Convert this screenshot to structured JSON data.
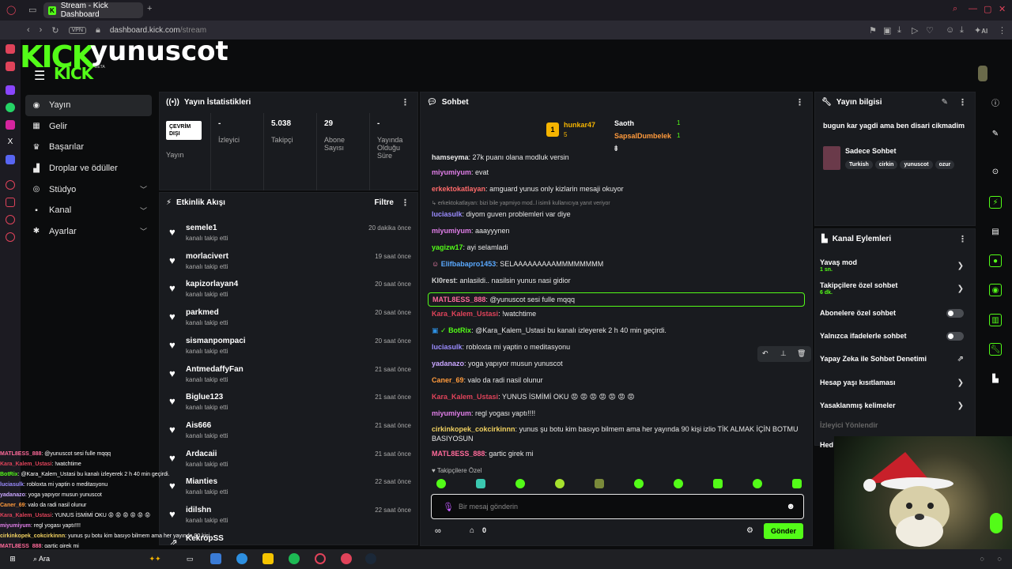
{
  "browser": {
    "tab_title": "Stream - Kick Dashboard",
    "vpn_label": "VPN",
    "url_host": "dashboard.kick.com",
    "url_path": "/stream",
    "ai_label": "AI"
  },
  "header": {
    "logo_top": "KICK",
    "logo_bottom": "KICK",
    "beta": "BETA",
    "channel_name": "yunuscot"
  },
  "nav": {
    "items": [
      {
        "label": "Yayın",
        "icon": "broadcast-icon"
      },
      {
        "label": "Gelir",
        "icon": "revenue-icon"
      },
      {
        "label": "Başarılar",
        "icon": "trophy-icon"
      },
      {
        "label": "Droplar ve ödüller",
        "icon": "gift-icon"
      },
      {
        "label": "Stüdyo",
        "icon": "studio-icon"
      },
      {
        "label": "Kanal",
        "icon": "channel-icon"
      },
      {
        "label": "Ayarlar",
        "icon": "gear-icon"
      }
    ]
  },
  "stats": {
    "title": "Yayın İstatistikleri",
    "offline_badge": "ÇEVRİM DIŞI",
    "broadcast_label": "Yayın",
    "viewers_value": "-",
    "viewers_label": "İzleyici",
    "followers_value": "5.038",
    "followers_label": "Takipçi",
    "subs_value": "29",
    "subs_label": "Abone Sayısı",
    "uptime_value": "-",
    "uptime_label": "Yayında Olduğu Süre"
  },
  "activity": {
    "title": "Etkinlik Akışı",
    "filter_label": "Filtre",
    "items": [
      {
        "user": "semele1",
        "action": "kanalı takip etti",
        "time": "20 dakika önce"
      },
      {
        "user": "morlacivert",
        "action": "kanalı takip etti",
        "time": "19 saat önce"
      },
      {
        "user": "kapizorlayan4",
        "action": "kanalı takip etti",
        "time": "20 saat önce"
      },
      {
        "user": "parkmed",
        "action": "kanalı takip etti",
        "time": "20 saat önce"
      },
      {
        "user": "sismanpompaci",
        "action": "kanalı takip etti",
        "time": "20 saat önce"
      },
      {
        "user": "AntmedaffyFan",
        "action": "kanalı takip etti",
        "time": "21 saat önce"
      },
      {
        "user": "Biglue123",
        "action": "kanalı takip etti",
        "time": "21 saat önce"
      },
      {
        "user": "Ais666",
        "action": "kanalı takip etti",
        "time": "21 saat önce"
      },
      {
        "user": "Ardacaii",
        "action": "kanalı takip etti",
        "time": "21 saat önce"
      },
      {
        "user": "Mianties",
        "action": "kanalı takip etti",
        "time": "22 saat önce"
      },
      {
        "user": "idilshn",
        "action": "kanalı takip etti",
        "time": "22 saat önce"
      },
      {
        "user": "KekropSS",
        "action": "",
        "time": ""
      }
    ]
  },
  "chat": {
    "title": "Sohbet",
    "leaderboard": [
      {
        "rank": "1",
        "user": "hunkar47",
        "count": "5"
      },
      {
        "rank": "",
        "user": "Saoth",
        "count": "1"
      },
      {
        "rank": "",
        "user": "SapsalDumbelek",
        "count": "1"
      }
    ],
    "messages": [
      {
        "user": "hamseyma",
        "color": "#e8e8e8",
        "text": "27k puanı olana modluk versin"
      },
      {
        "user": "miyumiyum",
        "color": "#e07ee8",
        "text": "evat"
      },
      {
        "user": "erkektokatlayan",
        "color": "#ff6a6a",
        "text": "amguard yunus only kizlarin mesaji okuyor"
      },
      {
        "user": "",
        "color": "#888888",
        "text": "erkektokatlayan: bizi bile yapmiyo mod..l isimli kullanıcıya yanıt veriyor"
      },
      {
        "user": "luciasulk",
        "color": "#9b8cff",
        "text": "diyom guven problemleri var diye"
      },
      {
        "user": "miyumiyum",
        "color": "#e07ee8",
        "text": "aaayyynen"
      },
      {
        "user": "yagizw17",
        "color": "#53fc18",
        "text": "ayi selamladi"
      },
      {
        "user": "Elifbabapro1453",
        "color": "#5aa9ff",
        "text": "SELAAAAAAAAAMMMMMMMM"
      },
      {
        "user": "Kl0rest",
        "color": "#d0d0d0",
        "text": "anlasildi.. nasilsin yunus nasi gidior"
      },
      {
        "user": "MATL8ESS_888",
        "color": "#ff6a9a",
        "text": "@yunuscot sesi fulle mqqq"
      },
      {
        "user": "Kara_Kalem_Ustasi",
        "color": "#e0435a",
        "text": "!watchtime"
      },
      {
        "user": "BotRix",
        "color": "#53fc18",
        "text": "@Kara_Kalem_Ustasi bu kanalı izleyerek 2 h 40 min geçirdi."
      },
      {
        "user": "luciasulk",
        "color": "#9b8cff",
        "text": "robloxta mi yaptin o meditasyonu"
      },
      {
        "user": "yadanazo",
        "color": "#c9a6ff",
        "text": "yoga yapıyor musun yunuscot"
      },
      {
        "user": "Caner_69",
        "color": "#ff9a3c",
        "text": "valo da radi nasil olunur"
      },
      {
        "user": "Kara_Kalem_Ustasi",
        "color": "#e0435a",
        "text": "YUNUS İSMİMİ OKU 😡 😡 😡 😡 😡 😡 😡"
      },
      {
        "user": "miyumiyum",
        "color": "#e07ee8",
        "text": "regl yogası yaptı!!!!"
      },
      {
        "user": "cirkinkopek_cokcirkinnn",
        "color": "#f0d060",
        "text": "yunus şu botu kim basıyo bilmem ama her yayında 90 kişi izlio TİK ALMAK İÇİN BOTMU BASIYOSUN"
      },
      {
        "user": "MATL8ESS_888",
        "color": "#ff6a9a",
        "text": "gartic girek mi"
      }
    ],
    "followers_only": "Takipçilere Özel",
    "input_placeholder": "Bir mesaj gönderin",
    "points": "0",
    "send_label": "Gönder"
  },
  "stream_info": {
    "title": "Yayın bilgisi",
    "description": "bugun kar yagdi ama ben disari cikmadim",
    "category": "Sadece Sohbet",
    "tags": [
      "Turkish",
      "cirkin",
      "yunuscot",
      "ozur"
    ]
  },
  "channel_actions": {
    "title": "Kanal Eylemleri",
    "slow_mode": "Yavaş mod",
    "slow_mode_value": "1 sn.",
    "followers_chat": "Takipçilere özel sohbet",
    "followers_chat_value": "6 dk.",
    "subs_chat": "Abonelere özel sohbet",
    "emote_chat": "Yalnızca ifadelerle sohbet",
    "ai_moderation": "Yapay Zeka ile Sohbet Denetimi",
    "age_restriction": "Hesap yaşı kısıtlaması",
    "banned_words": "Yasaklanmış kelimeler",
    "viewer_redirect": "İzleyici Yönlendir",
    "goal": "Hed"
  },
  "overlay_chat": [
    {
      "user": "MATL8ESS_888",
      "color": "#ff6a9a",
      "text": ": @yunuscot sesi fulle mqqq"
    },
    {
      "user": "Kara_Kalem_Ustasi",
      "color": "#e0435a",
      "text": ": !watchtime"
    },
    {
      "user": "BotRix",
      "color": "#53fc18",
      "text": ": @Kara_Kalem_Ustasi bu kanalı izleyerek 2 h 40 min geçirdi."
    },
    {
      "user": "luciasulk",
      "color": "#9b8cff",
      "text": ": robloxta mi yaptin o meditasyonu"
    },
    {
      "user": "yadanazo",
      "color": "#c9a6ff",
      "text": ": yoga yapıyor musun yunuscot"
    },
    {
      "user": "Caner_69",
      "color": "#ff9a3c",
      "text": ": valo da radi nasil olunur"
    },
    {
      "user": "Kara_Kalem_Ustasi",
      "color": "#e0435a",
      "text": ": YUNUS İSMİMİ OKU 😡 😡 😡 😡 😡 😡"
    },
    {
      "user": "miyumiyum",
      "color": "#e07ee8",
      "text": ": regl yogası yaptı!!!!"
    },
    {
      "user": "cirkinkopek_cokcirkinnn",
      "color": "#f0d060",
      "text": ": yunus şu botu kim basıyo bilmem ama her yayında 90 kişi"
    },
    {
      "user": "MATL8ESS_888",
      "color": "#ff6a9a",
      "text": ": gartic girek mi"
    }
  ],
  "taskbar": {
    "search_label": "Ara"
  },
  "colors": {
    "accent": "#53fc18",
    "panel": "#191b1f",
    "background": "#0b0c0d"
  }
}
